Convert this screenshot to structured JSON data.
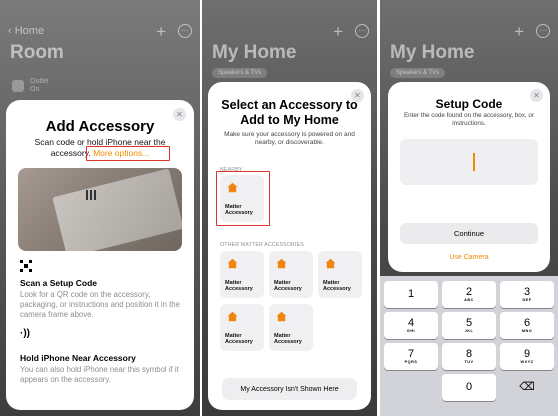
{
  "panel1": {
    "nav": {
      "back_label": "Home"
    },
    "room_title": "Room",
    "outlet": {
      "name": "Outlet",
      "status": "On"
    },
    "sheet": {
      "title": "Add Accessory",
      "subtitle": "Scan code or hold iPhone near the accessory.",
      "more_options": "More options...",
      "scan_title": "Scan a Setup Code",
      "scan_body": "Look for a QR code on the accessory, packaging, or instructions and position it in the camera frame above.",
      "hold_title": "Hold iPhone Near Accessory",
      "hold_body": "You can also hold iPhone near this symbol if it appears on the accessory."
    }
  },
  "panel2": {
    "home_title": "My Home",
    "chip_label": "Speakers & TVs",
    "sheet": {
      "title": "Select an Accessory to Add to My Home",
      "subtitle": "Make sure your accessory is powered on and nearby, or discoverable.",
      "nearby_label": "NEARBY",
      "nearby_tile": "Matter Accessory",
      "other_label": "OTHER MATTER ACCESSORIES",
      "other_tiles": [
        "Matter Accessory",
        "Matter Accessory",
        "Matter Accessory",
        "Matter Accessory",
        "Matter Accessory"
      ],
      "not_shown_button": "My Accessory Isn't Shown Here"
    }
  },
  "panel3": {
    "home_title": "My Home",
    "chip_label": "Speakers & TVs",
    "sheet": {
      "title": "Setup Code",
      "subtitle": "Enter the code found on the accessory, box, or instructions.",
      "code_value": "",
      "continue_button": "Continue",
      "use_camera": "Use Camera"
    },
    "keypad": [
      [
        {
          "num": "1",
          "let": ""
        },
        {
          "num": "2",
          "let": "ABC"
        },
        {
          "num": "3",
          "let": "DEF"
        }
      ],
      [
        {
          "num": "4",
          "let": "GHI"
        },
        {
          "num": "5",
          "let": "JKL"
        },
        {
          "num": "6",
          "let": "MNO"
        }
      ],
      [
        {
          "num": "7",
          "let": "PQRS"
        },
        {
          "num": "8",
          "let": "TUV"
        },
        {
          "num": "9",
          "let": "WXYZ"
        }
      ],
      [
        {
          "num": "",
          "let": ""
        },
        {
          "num": "0",
          "let": ""
        },
        {
          "num": "⌫",
          "let": ""
        }
      ]
    ]
  },
  "colors": {
    "accent": "#f08a00",
    "highlight": "#e0332c"
  }
}
